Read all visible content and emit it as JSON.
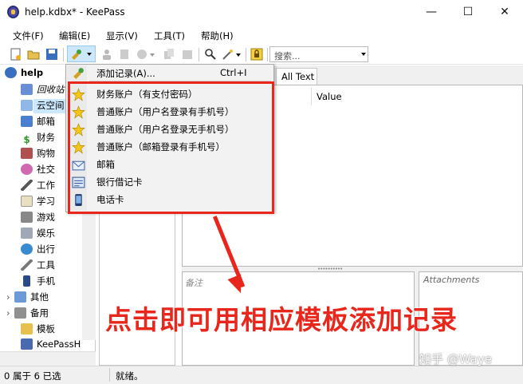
{
  "window": {
    "title": "help.kdbx* - KeePass",
    "minimize_glyph": "—",
    "maximize_glyph": "☐",
    "close_glyph": "✕"
  },
  "menubar": {
    "items": [
      "文件(F)",
      "编辑(E)",
      "显示(V)",
      "工具(T)",
      "帮助(H)"
    ]
  },
  "toolbar": {
    "search_placeholder": "搜索..."
  },
  "tree": {
    "root": "help",
    "items": [
      {
        "label": "回收站",
        "icon": "recycle-bin-icon",
        "italic": true
      },
      {
        "label": "云空间",
        "icon": "cloud-icon"
      },
      {
        "label": "邮箱",
        "icon": "mail-icon"
      },
      {
        "label": "财务",
        "icon": "dollar-icon"
      },
      {
        "label": "购物",
        "icon": "shopping-icon"
      },
      {
        "label": "社交",
        "icon": "social-icon"
      },
      {
        "label": "工作",
        "icon": "pen-icon"
      },
      {
        "label": "学习",
        "icon": "study-icon"
      },
      {
        "label": "游戏",
        "icon": "game-icon"
      },
      {
        "label": "娱乐",
        "icon": "printer-icon"
      },
      {
        "label": "出行",
        "icon": "globe-icon"
      },
      {
        "label": "工具",
        "icon": "wrench-icon"
      },
      {
        "label": "手机",
        "icon": "phone-icon"
      },
      {
        "label": "其他",
        "icon": "other-icon"
      },
      {
        "label": "备用",
        "icon": "backup-icon"
      },
      {
        "label": "模板",
        "icon": "folder-icon"
      },
      {
        "label": "KeePassH",
        "icon": "keepass-icon"
      }
    ]
  },
  "entry_view": {
    "tab_alltext": "All Text",
    "column_value": "Value",
    "notes_label": "备注",
    "attachments_label": "Attachments"
  },
  "dropdown": {
    "add_entry": "添加记录(A)...",
    "add_entry_shortcut": "Ctrl+I",
    "templates": [
      {
        "label": "财务账户（有支付密码）",
        "icon": "star-icon"
      },
      {
        "label": "普通账户（用户名登录有手机号）",
        "icon": "star-icon"
      },
      {
        "label": "普通账户（用户名登录无手机号）",
        "icon": "star-icon"
      },
      {
        "label": "普通账户（邮箱登录有手机号）",
        "icon": "star-icon"
      },
      {
        "label": "邮箱",
        "icon": "envelope-icon"
      },
      {
        "label": "银行借记卡",
        "icon": "card-icon"
      },
      {
        "label": "电话卡",
        "icon": "phone-icon"
      }
    ]
  },
  "statusbar": {
    "left": "0 属于 6 已选",
    "right": "就绪。"
  },
  "annotation": {
    "text": "点击即可用相应模板添加记录"
  },
  "watermark": "知乎 @Waye",
  "colors": {
    "annotation_red": "#e8261b",
    "selection_blue": "#cce8ff"
  }
}
